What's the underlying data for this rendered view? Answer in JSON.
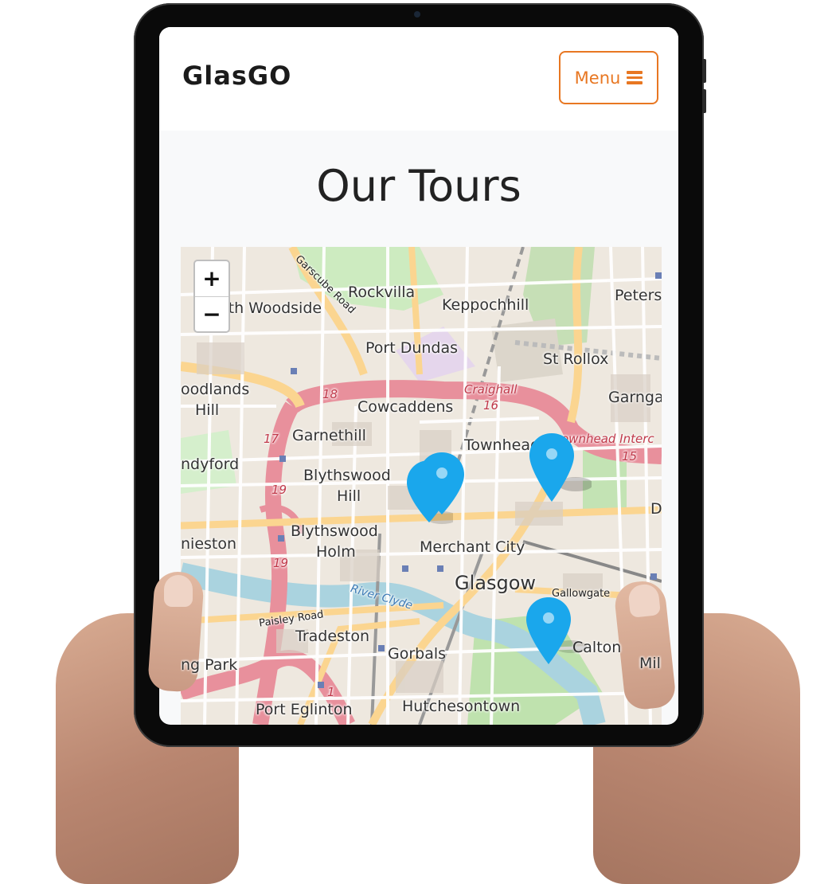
{
  "app": {
    "brand": "GlasGO",
    "menu_label": "Menu"
  },
  "page": {
    "title": "Our Tours"
  },
  "map": {
    "zoom_in": "+",
    "zoom_out": "−",
    "labels": {
      "rockvilla": "Rockvilla",
      "keppochhill": "Keppochhill",
      "peters": "Peters",
      "north_woodside": "North Woodside",
      "garscube_road": "Garscube Road",
      "port_dundas": "Port Dundas",
      "st_rollox": "St Rollox",
      "woodlands": "oodlands",
      "hill": "Hill",
      "craighall": "Craighall",
      "garnga": "Garnga",
      "cowcaddens": "Cowcaddens",
      "garnethill": "Garnethill",
      "townhead": "Townhead",
      "townhead_interchange": "ownhead Interc",
      "sandyford": "ndyford",
      "blythswood_hill_1": "Blythswood",
      "blythswood_hill_2": "Hill",
      "blythswood_holm_1": "Blythswood",
      "blythswood_holm_2": "Holm",
      "anniesland": "nieston",
      "merchant_city": "Merchant City",
      "glasgow": "Glasgow",
      "gallowgate": "Gallowgate",
      "river_clyde": "River Clyde",
      "paisley_road": "Paisley Road",
      "tradeston": "Tradeston",
      "gorbals": "Gorbals",
      "calton": "Calton",
      "mile_end": "Mil",
      "kinning_park": "ng Park",
      "port_eglinton": "Port Eglinton",
      "hutchesontown": "Hutchesontown",
      "d_edge": "D",
      "road_18": "18",
      "road_16": "16",
      "road_17": "17",
      "road_19a": "19",
      "road_19b": "19",
      "road_15": "15",
      "road_1": "1"
    },
    "marker_color": "#1aa7ec"
  },
  "colors": {
    "accent": "#e87722",
    "brand_text": "#1b1b1b",
    "page_bg": "#f8f9fa"
  }
}
